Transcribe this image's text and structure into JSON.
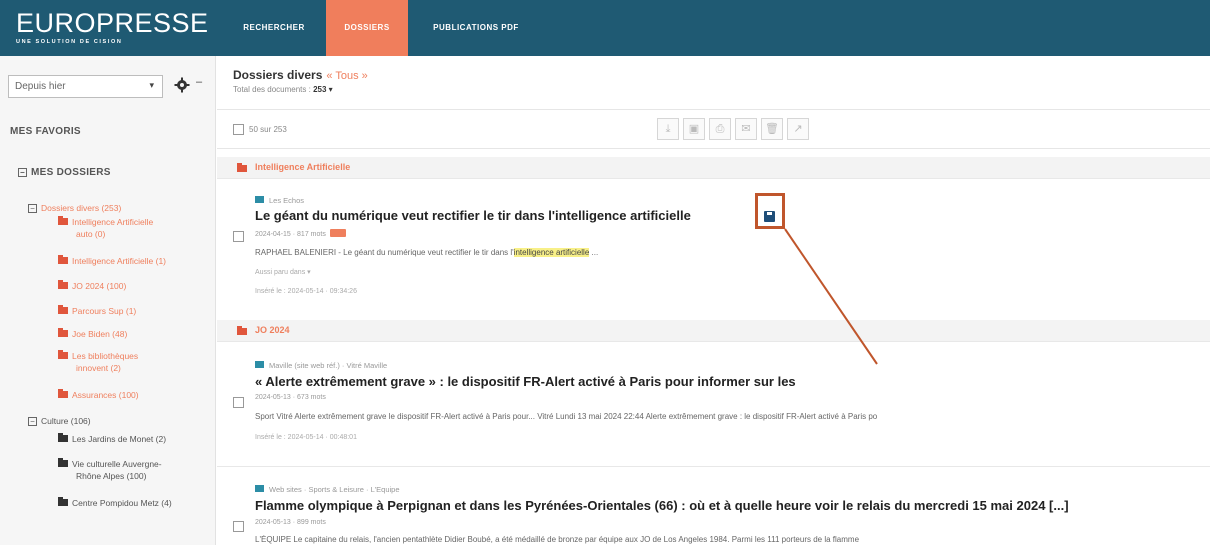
{
  "header": {
    "logo": "EUROPRESSE",
    "logo_sub": "UNE SOLUTION DE CISION",
    "tabs": [
      {
        "label": "RECHERCHER"
      },
      {
        "label": "DOSSIERS"
      },
      {
        "label": "PUBLICATIONS PDF"
      }
    ]
  },
  "sidebar": {
    "period_select": "Depuis hier",
    "favoris_label": "MES FAVORIS",
    "dossiers_label": "MES DOSSIERS",
    "tree": [
      {
        "label": "Dossiers divers (253)"
      },
      {
        "label": "Intelligence Artificielle"
      },
      {
        "label": "auto (0)"
      },
      {
        "label": "Intelligence Artificielle (1)"
      },
      {
        "label": "JO 2024 (100)"
      },
      {
        "label": "Parcours Sup (1)"
      },
      {
        "label": "Joe Biden (48)"
      },
      {
        "label": "Les bibliothèques"
      },
      {
        "label": "innovent (2)"
      },
      {
        "label": "Assurances (100)"
      },
      {
        "label": "Culture (106)"
      },
      {
        "label": "Les Jardins de Monet (2)"
      },
      {
        "label": "Vie culturelle Auvergne-"
      },
      {
        "label": "Rhône Alpes (100)"
      },
      {
        "label": "Centre Pompidou Metz (4)"
      }
    ]
  },
  "main": {
    "title": "Dossiers divers",
    "tous_label": "« Tous »",
    "total_label": "Total des documents :",
    "total_value": "253 ▾",
    "select_count": "50 sur 253",
    "sections": [
      {
        "label": "Intelligence Artificielle"
      },
      {
        "label": "JO 2024"
      }
    ],
    "articles": [
      {
        "source": "Les Echos",
        "headline": "Le géant du numérique veut rectifier le tir dans l'intelligence artificielle",
        "meta": "2024-04-15 · 817 mots",
        "snippet_before": "RAPHAEL BALENIERI - Le géant du numérique veut rectifier le tir dans l'",
        "snippet_highlight": "intelligence artificielle",
        "snippet_after": " ...",
        "extra": "Aussi paru dans ▾",
        "inserted": "Inséré le : 2024-05-14 · 09:34:26"
      },
      {
        "source": "Maville (site web réf.) · Vitré Maville",
        "headline": "« Alerte extrêmement grave » : le dispositif FR-Alert activé à Paris pour informer sur les",
        "meta": "2024-05-13 · 673 mots",
        "snippet": "Sport Vitré Alerte extrêmement grave le dispositif FR-Alert activé à Paris pour... Vitré Lundi 13 mai 2024 22:44 Alerte extrêmement grave : le dispositif FR-Alert activé à Paris po",
        "inserted": "Inséré le : 2024-05-14 · 00:48:01"
      },
      {
        "source": "Web sites · Sports & Leisure · L'Equipe",
        "headline": "Flamme olympique à Perpignan et dans les Pyrénées-Orientales (66) : où et à quelle heure voir le relais du mercredi 15 mai 2024 [...]",
        "meta": "2024-05-13 · 899 mots",
        "snippet": "L'ÉQUIPE Le capitaine du relais, l'ancien pentathlète Didier Boubé, a été médaillé de bronze par équipe aux JO de Los Angeles 1984. Parmi les 111 porteurs de la flamme"
      }
    ]
  },
  "colors": {
    "topbar": "#1f5a73",
    "accent": "#f07e5c",
    "callout": "#c0562c"
  }
}
